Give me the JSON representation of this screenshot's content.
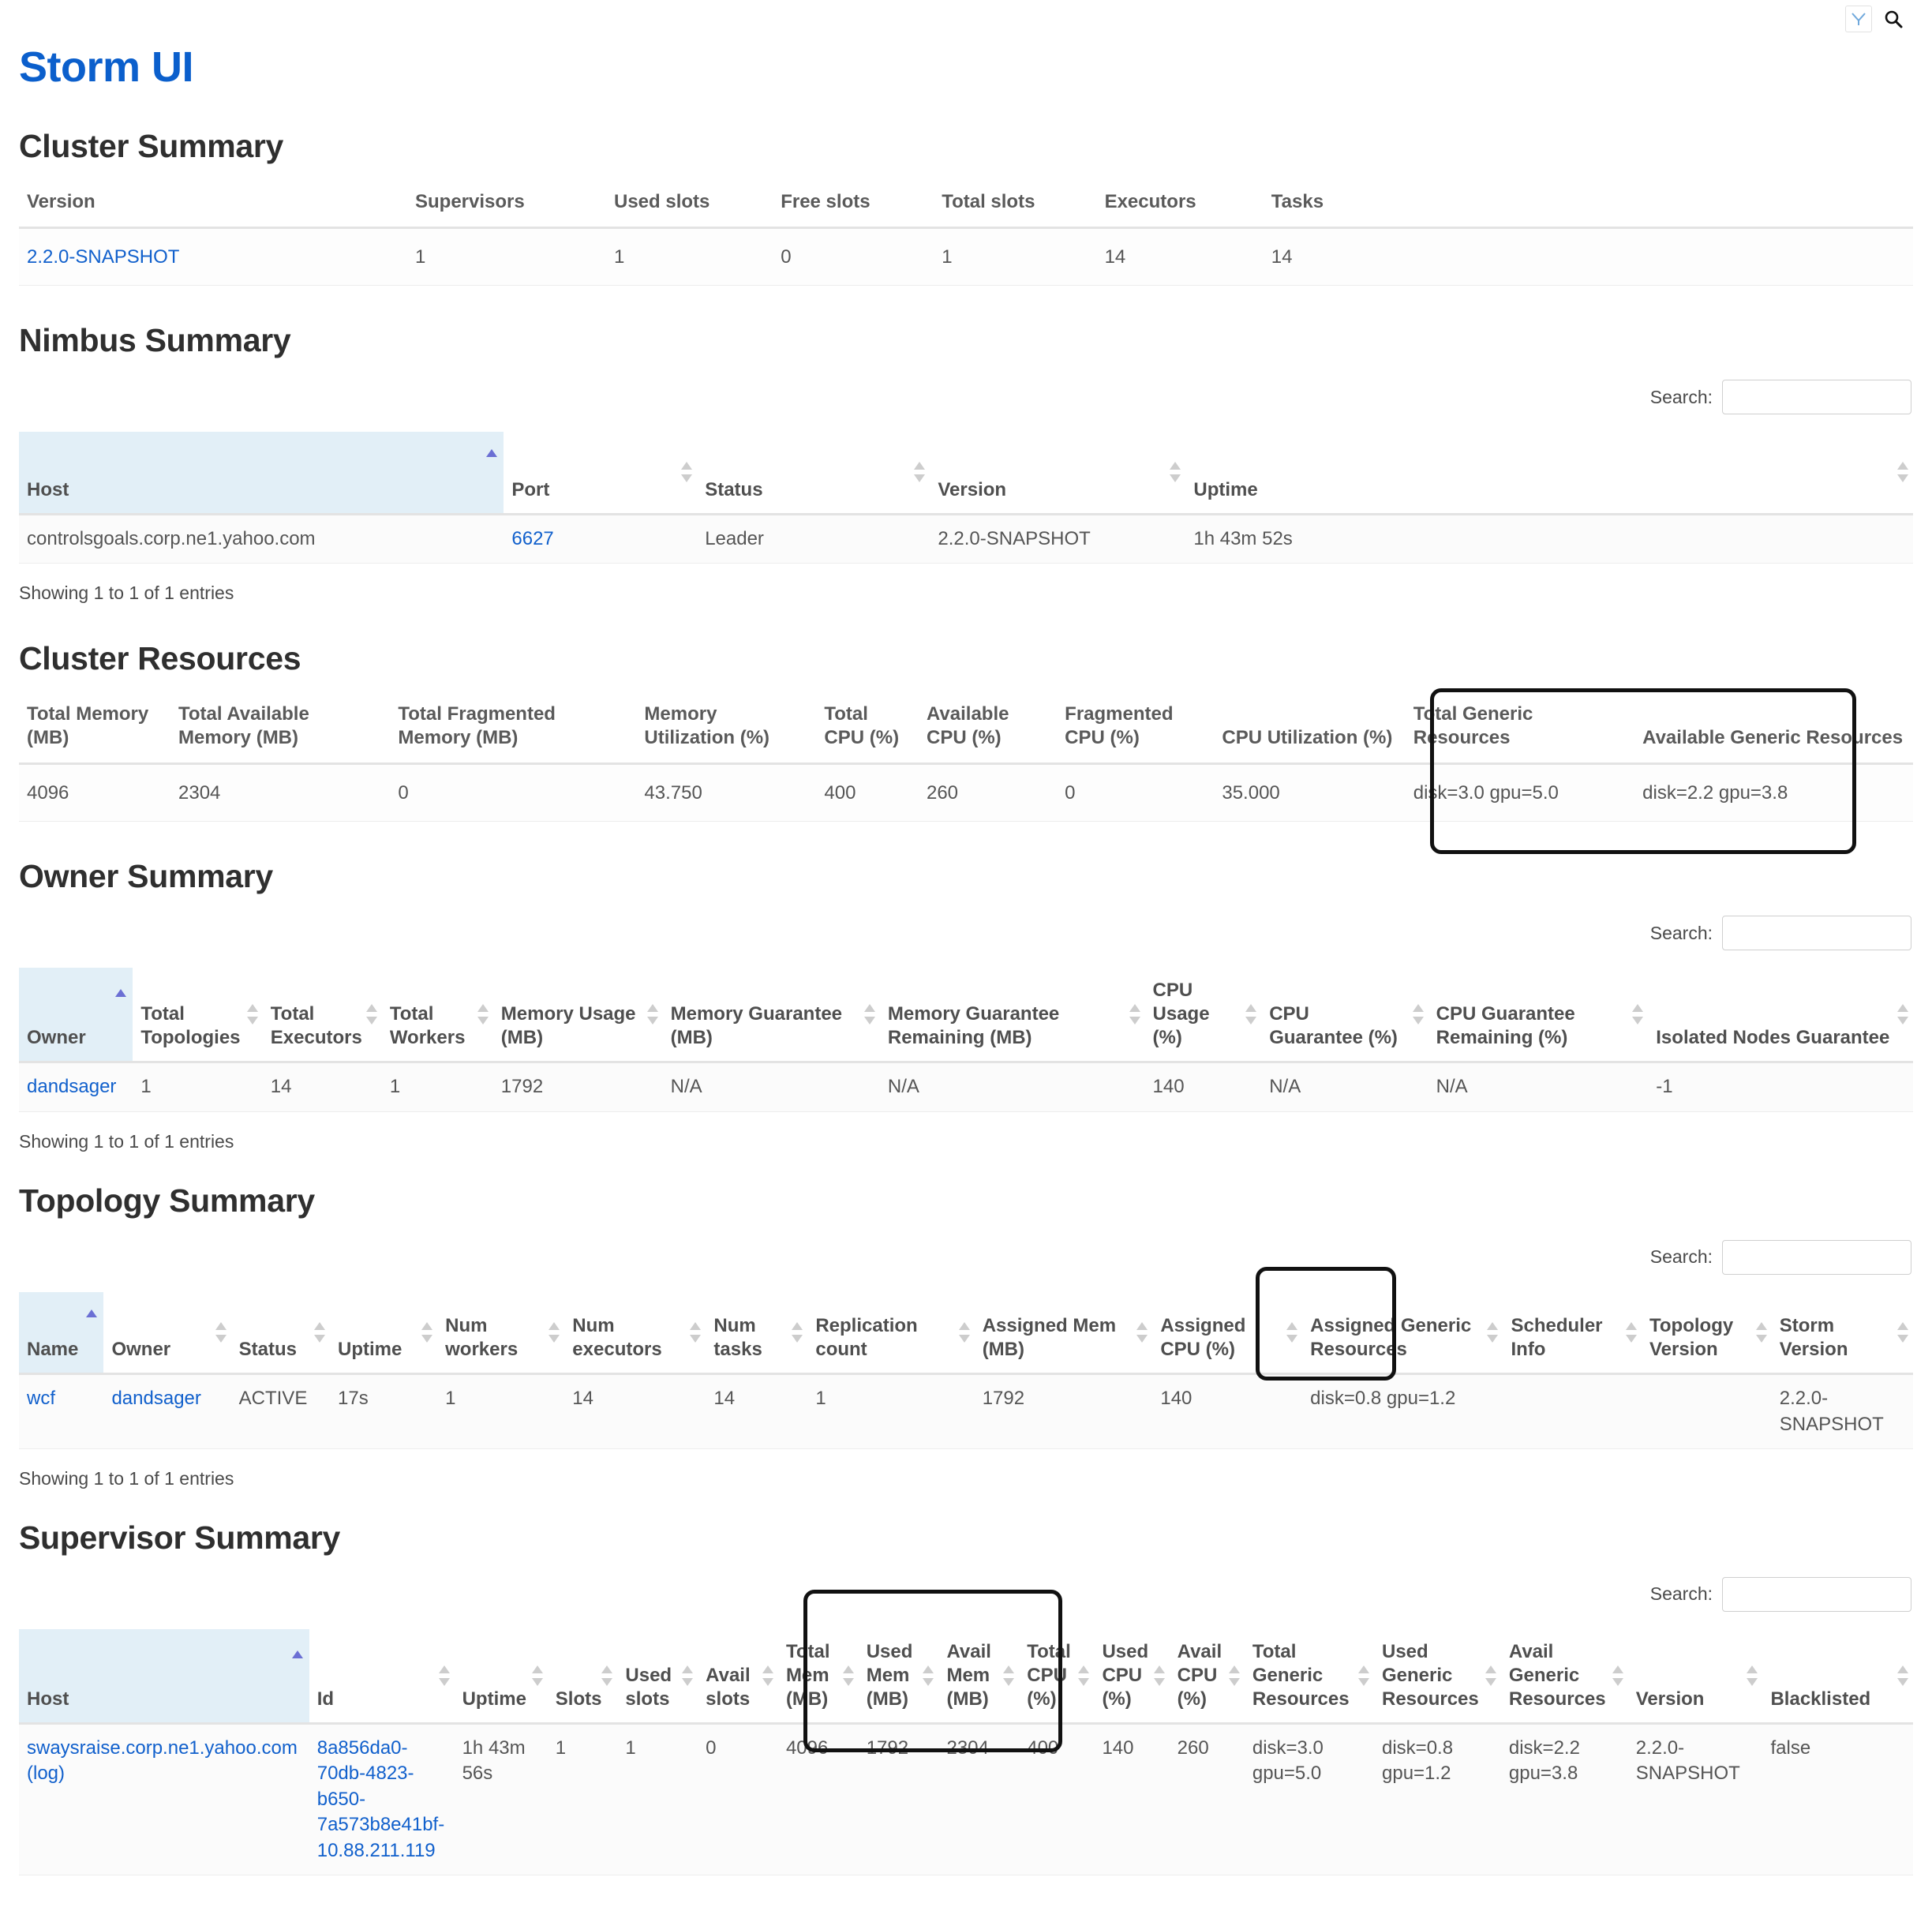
{
  "topbar": {
    "yahoo_logo": "Y",
    "search_icon": "search"
  },
  "brand_title": "Storm UI",
  "cluster_summary": {
    "heading": "Cluster Summary",
    "columns": [
      "Version",
      "Supervisors",
      "Used slots",
      "Free slots",
      "Total slots",
      "Executors",
      "Tasks"
    ],
    "rows": [
      [
        "2.2.0-SNAPSHOT",
        "1",
        "1",
        "0",
        "1",
        "14",
        "14"
      ]
    ]
  },
  "nimbus_summary": {
    "heading": "Nimbus Summary",
    "search_label": "Search:",
    "search_value": "",
    "columns": [
      "Host",
      "Port",
      "Status",
      "Version",
      "Uptime"
    ],
    "sorted_column": "Host",
    "rows": [
      [
        "controlsgoals.corp.ne1.yahoo.com",
        "6627",
        "Leader",
        "2.2.0-SNAPSHOT",
        "1h 43m 52s"
      ]
    ],
    "info": "Showing 1 to 1 of 1 entries"
  },
  "cluster_resources": {
    "heading": "Cluster Resources",
    "columns": [
      "Total Memory (MB)",
      "Total Available Memory (MB)",
      "Total Fragmented Memory (MB)",
      "Memory Utilization (%)",
      "Total CPU (%)",
      "Available CPU (%)",
      "Fragmented CPU (%)",
      "CPU Utilization (%)",
      "Total Generic Resources",
      "Available Generic Resources"
    ],
    "rows": [
      [
        "4096",
        "2304",
        "0",
        "43.750",
        "400",
        "260",
        "0",
        "35.000",
        "disk=3.0 gpu=5.0",
        "disk=2.2 gpu=3.8"
      ]
    ]
  },
  "owner_summary": {
    "heading": "Owner Summary",
    "search_label": "Search:",
    "search_value": "",
    "columns": [
      "Owner",
      "Total Topologies",
      "Total Executors",
      "Total Workers",
      "Memory Usage (MB)",
      "Memory Guarantee (MB)",
      "Memory Guarantee Remaining (MB)",
      "CPU Usage (%)",
      "CPU Guarantee (%)",
      "CPU Guarantee Remaining (%)",
      "Isolated Nodes Guarantee"
    ],
    "sorted_column": "Owner",
    "rows": [
      [
        "dandsager",
        "1",
        "14",
        "1",
        "1792",
        "N/A",
        "N/A",
        "140",
        "N/A",
        "N/A",
        "-1"
      ]
    ],
    "info": "Showing 1 to 1 of 1 entries"
  },
  "topology_summary": {
    "heading": "Topology Summary",
    "search_label": "Search:",
    "search_value": "",
    "columns": [
      "Name",
      "Owner",
      "Status",
      "Uptime",
      "Num workers",
      "Num executors",
      "Num tasks",
      "Replication count",
      "Assigned Mem (MB)",
      "Assigned CPU (%)",
      "Assigned Generic Resources",
      "Scheduler Info",
      "Topology Version",
      "Storm Version"
    ],
    "sorted_column": "Name",
    "rows": [
      [
        "wcf",
        "dandsager",
        "ACTIVE",
        "17s",
        "1",
        "14",
        "14",
        "1",
        "1792",
        "140",
        "disk=0.8 gpu=1.2",
        "",
        "",
        "2.2.0-SNAPSHOT"
      ]
    ],
    "info": "Showing 1 to 1 of 1 entries"
  },
  "supervisor_summary": {
    "heading": "Supervisor Summary",
    "search_label": "Search:",
    "search_value": "",
    "columns": [
      "Host",
      "Id",
      "Uptime",
      "Slots",
      "Used slots",
      "Avail slots",
      "Total Mem (MB)",
      "Used Mem (MB)",
      "Avail Mem (MB)",
      "Total CPU (%)",
      "Used CPU (%)",
      "Avail CPU (%)",
      "Total Generic Resources",
      "Used Generic Resources",
      "Avail Generic Resources",
      "Version",
      "Blacklisted"
    ],
    "sorted_column": "Host",
    "rows": [
      {
        "host": "swaysraise.corp.ne1.yahoo.com",
        "host_log": "(log)",
        "id": "8a856da0-70db-4823-b650-7a573b8e41bf-10.88.211.119",
        "uptime": "1h 43m 56s",
        "slots": "1",
        "used_slots": "1",
        "avail_slots": "0",
        "total_mem": "4096",
        "used_mem": "1792",
        "avail_mem": "2304",
        "total_cpu": "400",
        "used_cpu": "140",
        "avail_cpu": "260",
        "total_generic": "disk=3.0 gpu=5.0",
        "used_generic": "disk=0.8 gpu=1.2",
        "avail_generic": "disk=2.2 gpu=3.8",
        "version": "2.2.0-SNAPSHOT",
        "blacklisted": "false"
      }
    ]
  },
  "annotations": {
    "accent_color": "#0b5fcc",
    "highlight_color": "#111111",
    "sorted_header_bg": "#e2eff7"
  }
}
